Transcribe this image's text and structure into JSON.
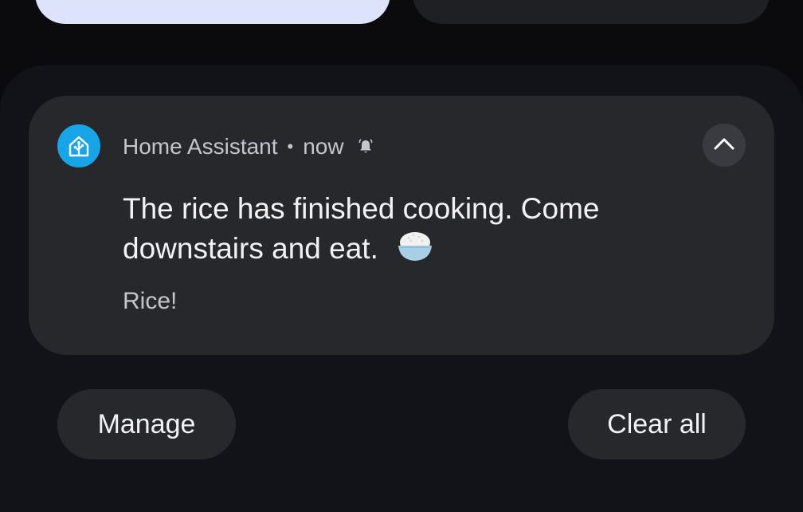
{
  "notification": {
    "app_name": "Home Assistant",
    "separator": "•",
    "time": "now",
    "title": "The rice has finished cooking. Come downstairs and eat.",
    "body": "Rice!",
    "app_icon": "home-assistant-icon",
    "alert_icon": "bell-ringing-icon",
    "expand_icon": "chevron-up-icon",
    "emoji": "rice-bowl-icon",
    "app_icon_color": "#18a5e8"
  },
  "actions": {
    "manage_label": "Manage",
    "clear_all_label": "Clear all"
  },
  "colors": {
    "background": "#0b0b0d",
    "panel": "#121318",
    "card": "#27282c",
    "quick_tile_active": "#dde3fb",
    "quick_tile_inactive": "#1f2024"
  }
}
